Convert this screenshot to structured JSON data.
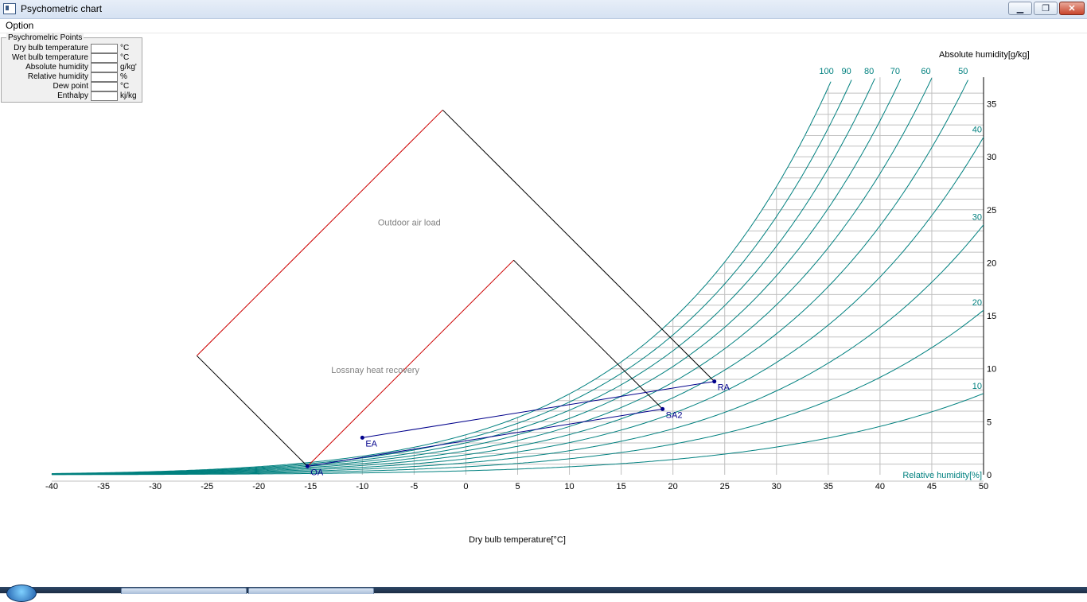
{
  "window": {
    "title": "Psychometric chart",
    "buttons": {
      "minimize": "▁",
      "maximize": "❐",
      "close": "✕"
    }
  },
  "menu": {
    "option": "Option"
  },
  "points_panel": {
    "title": "Psychromelric Points",
    "rows": [
      {
        "label": "Dry bulb temperature",
        "unit": "°C",
        "value": ""
      },
      {
        "label": "Wet bulb temperature",
        "unit": "°C",
        "value": ""
      },
      {
        "label": "Absolute humidity",
        "unit": "g/kg'",
        "value": ""
      },
      {
        "label": "Relative humidity",
        "unit": "%",
        "value": ""
      },
      {
        "label": "Dew point",
        "unit": "°C",
        "value": ""
      },
      {
        "label": "Enthalpy",
        "unit": "kj/kg",
        "value": ""
      }
    ]
  },
  "chart_data": {
    "type": "line",
    "xlabel": "Dry bulb temperature[°C]",
    "ylabel": "Absolute humidity[g/kg]",
    "rh_label": "Relative humidity[%]",
    "xlim": [
      -40,
      50
    ],
    "ylim": [
      0,
      36
    ],
    "x_ticks": [
      -40,
      -35,
      -30,
      -25,
      -20,
      -15,
      -10,
      -5,
      0,
      5,
      10,
      15,
      20,
      25,
      30,
      35,
      40,
      45,
      50
    ],
    "y_ticks": [
      0,
      5,
      10,
      15,
      20,
      25,
      30,
      35
    ],
    "grid": true,
    "rh_curves": [
      100,
      90,
      80,
      70,
      60,
      50,
      40,
      30,
      20,
      10
    ],
    "rh_labels_top": [
      "100",
      "90",
      "80",
      "70",
      "60",
      "50"
    ],
    "rh_labels_right": [
      "40",
      "30",
      "20",
      "10"
    ],
    "points": [
      {
        "name": "OA",
        "x": -15.3,
        "y": 0.8
      },
      {
        "name": "EA",
        "x": -10,
        "y": 3.5
      },
      {
        "name": "SA2",
        "x": 19,
        "y": 6.2
      },
      {
        "name": "RA",
        "x": 24,
        "y": 8.8
      }
    ],
    "lines": [
      {
        "from": "OA",
        "to": "SA2"
      },
      {
        "from": "EA",
        "to": "RA"
      }
    ],
    "annotations": [
      {
        "text": "Outdoor air load",
        "x": -8.5,
        "y": 23.5
      },
      {
        "text": "Lossnay heat recovery",
        "x": -13,
        "y": 9.6
      }
    ],
    "colors": {
      "rh_curve": "#00807f",
      "grid": "#c0c0c0",
      "process": "#00008b",
      "box_red": "#cc0000",
      "box_black": "#000000",
      "annotation": "#808080"
    }
  }
}
